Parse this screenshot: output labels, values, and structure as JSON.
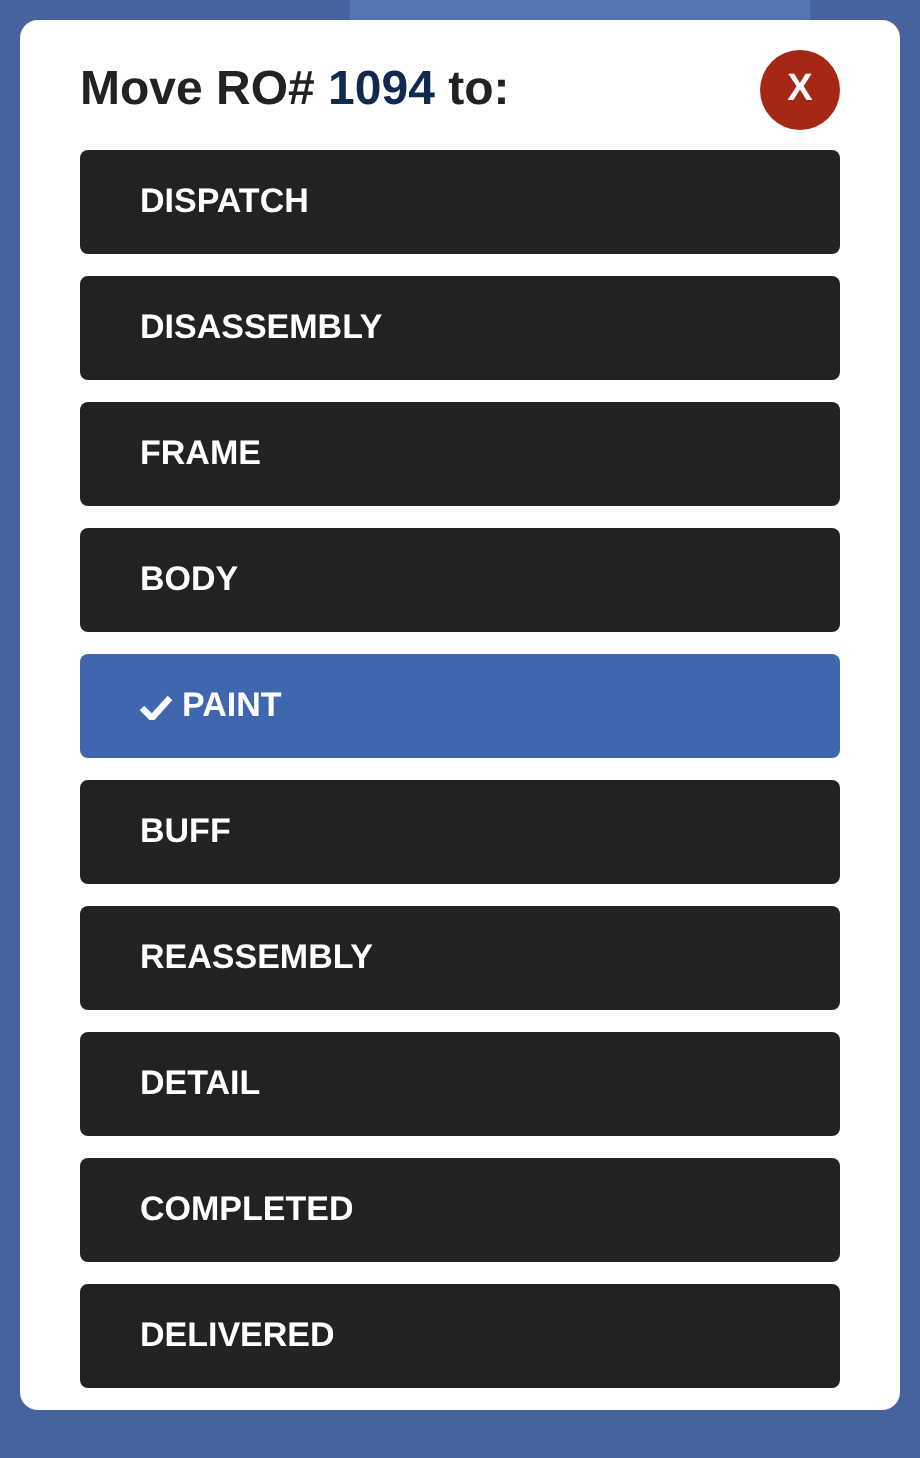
{
  "dialog": {
    "title_prefix": "Move RO#",
    "ro_number": "1094",
    "title_suffix": "to:",
    "close_label": "X"
  },
  "stages": [
    {
      "label": "DISPATCH",
      "selected": false
    },
    {
      "label": "DISASSEMBLY",
      "selected": false
    },
    {
      "label": "FRAME",
      "selected": false
    },
    {
      "label": "BODY",
      "selected": false
    },
    {
      "label": "PAINT",
      "selected": true
    },
    {
      "label": "BUFF",
      "selected": false
    },
    {
      "label": "REASSEMBLY",
      "selected": false
    },
    {
      "label": "DETAIL",
      "selected": false
    },
    {
      "label": "COMPLETED",
      "selected": false
    },
    {
      "label": "DELIVERED",
      "selected": false
    }
  ]
}
